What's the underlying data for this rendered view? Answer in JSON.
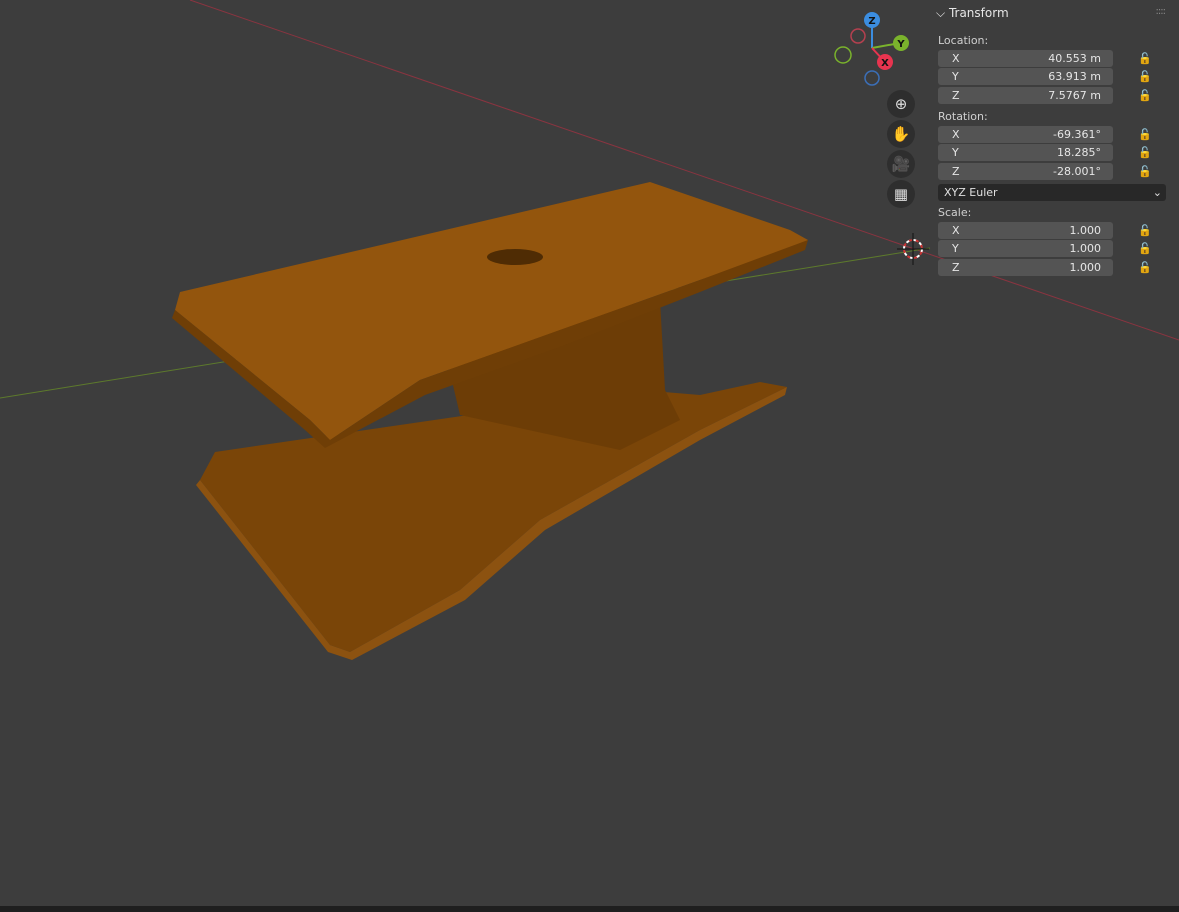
{
  "gizmo": {
    "z": "Z",
    "y": "Y",
    "x": "X"
  },
  "nav": {
    "zoom": "zoom-icon",
    "pan": "hand-icon",
    "camera": "camera-icon",
    "grid": "grid-icon"
  },
  "panel": {
    "title": "Transform",
    "location_label": "Location:",
    "location": [
      {
        "axis": "X",
        "value": "40.553 m"
      },
      {
        "axis": "Y",
        "value": "63.913 m"
      },
      {
        "axis": "Z",
        "value": "7.5767 m"
      }
    ],
    "rotation_label": "Rotation:",
    "rotation": [
      {
        "axis": "X",
        "value": "-69.361°"
      },
      {
        "axis": "Y",
        "value": "18.285°"
      },
      {
        "axis": "Z",
        "value": "-28.001°"
      }
    ],
    "rotation_mode": "XYZ Euler",
    "scale_label": "Scale:",
    "scale": [
      {
        "axis": "X",
        "value": "1.000"
      },
      {
        "axis": "Y",
        "value": "1.000"
      },
      {
        "axis": "Z",
        "value": "1.000"
      }
    ]
  },
  "colors": {
    "background": "#3d3d3d",
    "object": "#9a5a0c",
    "x_axis": "#e8344f",
    "y_axis": "#7ab32c",
    "z_axis": "#3b8de0"
  }
}
